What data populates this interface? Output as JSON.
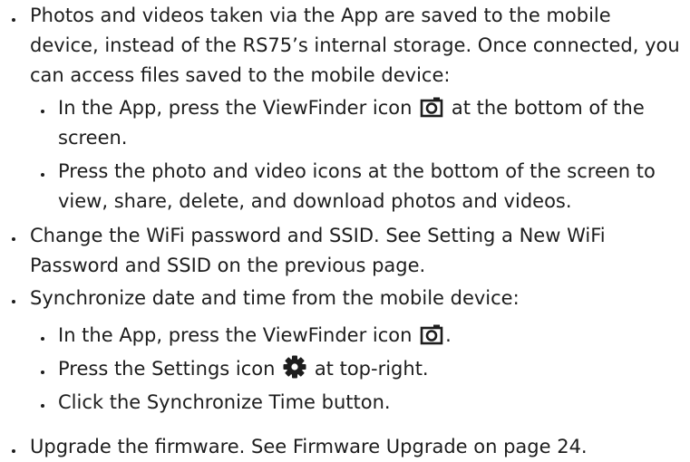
{
  "items": [
    {
      "text": "Photos and videos taken via the App are saved to the mobile device, instead of the RS75’s internal storage. Once connected, you can access files saved to the mobile device:"
    },
    {
      "before": "In the App, press the ViewFinder icon",
      "icon": "camera-icon",
      "after": "at the bottom of the screen."
    },
    {
      "text": "Press the photo and video icons at the bottom of the screen to view, share, delete, and download photos and videos."
    },
    {
      "text": "Change the WiFi password and SSID. See Setting a New WiFi Password and SSID on the previous page."
    },
    {
      "text": "Synchronize date and time from the mobile device:"
    },
    {
      "before": "In the App, press the ViewFinder icon",
      "icon": "camera-icon",
      "after": "."
    },
    {
      "before": "Press the Settings icon",
      "icon": "gear-icon",
      "after": "at top-right."
    },
    {
      "text": "Click the Synchronize Time button."
    },
    {
      "text": "Upgrade the firmware. See Firmware Upgrade on page 24."
    }
  ]
}
